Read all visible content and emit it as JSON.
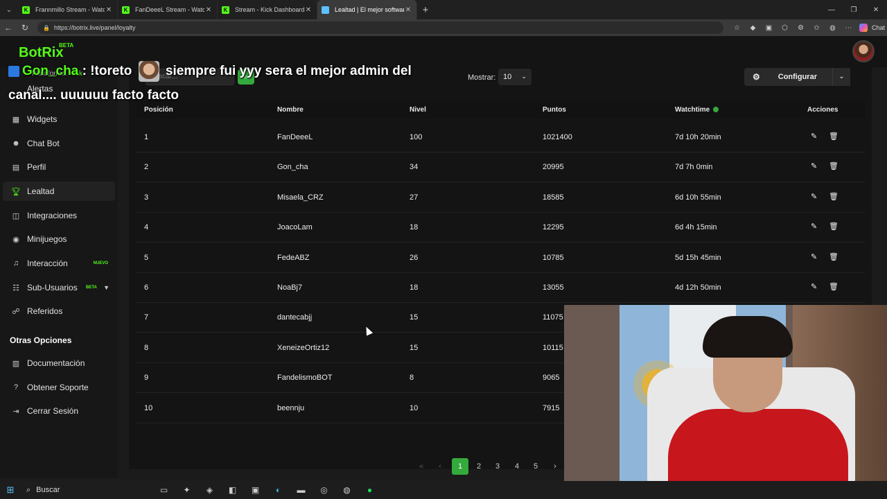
{
  "browser": {
    "tabs": [
      {
        "label": "Frannmillo Stream - Watch Liv",
        "icon": "kick-favicon",
        "active": false
      },
      {
        "label": "FanDeeeL Stream - Watch Live on",
        "icon": "kick-favicon",
        "active": false
      },
      {
        "label": "Stream - Kick Dashboard",
        "icon": "kick-favicon",
        "active": false
      },
      {
        "label": "Lealtad | El mejor software para p",
        "icon": "botrix-favicon",
        "active": true
      }
    ],
    "url": "https://botrix.live/panel/loyalty",
    "chat_label": "Chat"
  },
  "brand": {
    "name": "BotRix",
    "badge": "BETA"
  },
  "sidebar": {
    "platform_label": "Plataforma:",
    "platform_value": "Kick",
    "partial_item": "Alertas",
    "items": [
      {
        "label": "Widgets",
        "icon": "widgets-icon"
      },
      {
        "label": "Chat Bot",
        "icon": "robot-icon"
      },
      {
        "label": "Perfil",
        "icon": "profile-icon"
      },
      {
        "label": "Lealtad",
        "icon": "trophy-icon"
      },
      {
        "label": "Integraciones",
        "icon": "integrations-icon"
      },
      {
        "label": "Minijuegos",
        "icon": "gamepad-icon"
      },
      {
        "label": "Interacción",
        "icon": "music-icon",
        "tag": "NUEVO"
      },
      {
        "label": "Sub-Usuarios",
        "icon": "users-icon",
        "tag": "BETA"
      },
      {
        "label": "Referidos",
        "icon": "referrals-icon"
      }
    ],
    "section_title": "Otras Opciones",
    "other_items": [
      {
        "label": "Documentación",
        "icon": "document-icon"
      },
      {
        "label": "Obtener Soporte",
        "icon": "help-icon"
      },
      {
        "label": "Cerrar Sesión",
        "icon": "logout-icon"
      }
    ]
  },
  "toolbar": {
    "search_placeholder": "Buscar...",
    "show_label": "Mostrar:",
    "show_value": "10",
    "configure_label": "Configurar"
  },
  "table": {
    "headers": [
      "Posición",
      "Nombre",
      "Nivel",
      "Puntos",
      "Watchtime",
      "Acciones"
    ],
    "rows": [
      {
        "pos": "1",
        "name": "FanDeeeL",
        "level": "100",
        "points": "1021400",
        "watchtime": "7d 10h 20min"
      },
      {
        "pos": "2",
        "name": "Gon_cha",
        "level": "34",
        "points": "20995",
        "watchtime": "7d 7h 0min"
      },
      {
        "pos": "3",
        "name": "Misaela_CRZ",
        "level": "27",
        "points": "18585",
        "watchtime": "6d 10h 55min"
      },
      {
        "pos": "4",
        "name": "JoacoLam",
        "level": "18",
        "points": "12295",
        "watchtime": "6d 4h 15min"
      },
      {
        "pos": "5",
        "name": "FedeABZ",
        "level": "26",
        "points": "10785",
        "watchtime": "5d 15h 45min"
      },
      {
        "pos": "6",
        "name": "NoaBj7",
        "level": "18",
        "points": "13055",
        "watchtime": "4d 12h 50min"
      },
      {
        "pos": "7",
        "name": "dantecabjj",
        "level": "15",
        "points": "11075",
        "watchtime": ""
      },
      {
        "pos": "8",
        "name": "XeneizeOrtiz12",
        "level": "15",
        "points": "10115",
        "watchtime": ""
      },
      {
        "pos": "9",
        "name": "FandelismoBOT",
        "level": "8",
        "points": "9065",
        "watchtime": ""
      },
      {
        "pos": "10",
        "name": "beennju",
        "level": "10",
        "points": "7915",
        "watchtime": ""
      }
    ]
  },
  "pagination": {
    "pages": [
      "1",
      "2",
      "3",
      "4",
      "5"
    ],
    "current": "1"
  },
  "overlay": {
    "user": "Gon_cha",
    "line1_prefix": ": !toreto",
    "line1_suffix": "siempre fui yyy sera el mejor admin del",
    "line2": "canal.... uuuuuu facto facto"
  },
  "taskbar": {
    "search_label": "Buscar"
  },
  "colors": {
    "accent": "#53fc18",
    "button_green": "#34a93c",
    "background": "#1b1b1b"
  }
}
